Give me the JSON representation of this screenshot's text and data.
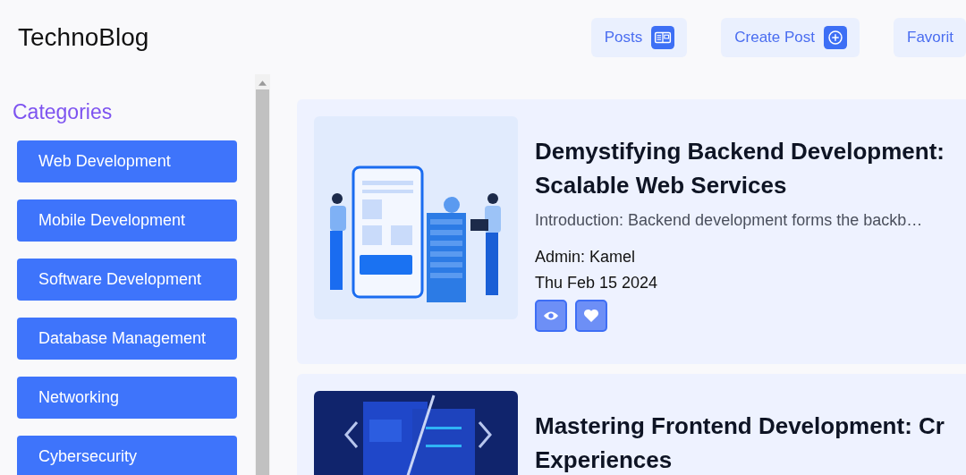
{
  "logo": "TechnoBlog",
  "nav": [
    {
      "label": "Posts"
    },
    {
      "label": "Create Post"
    },
    {
      "label": "Favorit"
    }
  ],
  "sidebar": {
    "title": "Categories",
    "items": [
      "Web Development",
      "Mobile Development",
      "Software Development",
      "Database Management",
      "Networking",
      "Cybersecurity"
    ]
  },
  "posts": [
    {
      "title_lines": [
        "Demystifying Backend Development:",
        "Scalable Web Services"
      ],
      "excerpt": "Introduction: Backend development forms the backb…",
      "author": "Admin: Kamel",
      "date": "Thu Feb 15 2024"
    },
    {
      "title_lines": [
        "Mastering Frontend Development: Cr",
        "Experiences"
      ]
    }
  ]
}
